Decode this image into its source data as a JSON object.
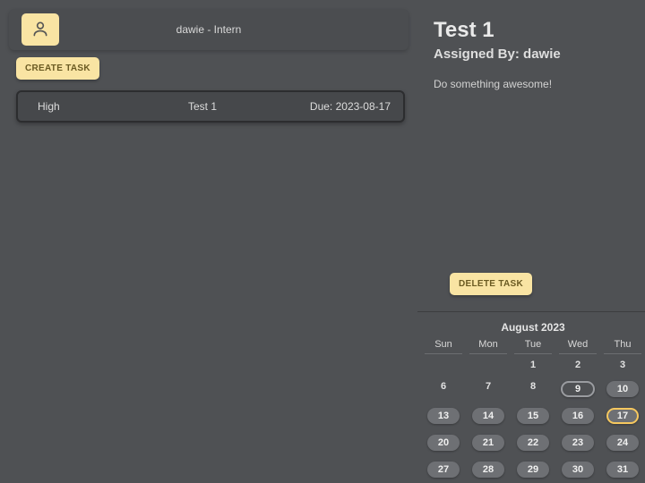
{
  "header": {
    "user_role": "dawie - Intern"
  },
  "actions": {
    "create_task": "CREATE TASK",
    "delete_task": "DELETE TASK"
  },
  "tasks": [
    {
      "priority": "High",
      "title": "Test 1",
      "due_prefix": "Due: ",
      "due": "2023-08-17"
    }
  ],
  "detail": {
    "title": "Test 1",
    "assigned_prefix": "Assigned By: ",
    "assigned_by": "dawie",
    "description": "Do something awesome!"
  },
  "calendar": {
    "title": "August 2023",
    "weekdays": [
      "Sun",
      "Mon",
      "Tue",
      "Wed",
      "Thu"
    ],
    "rows": [
      [
        {
          "n": "",
          "pill": false
        },
        {
          "n": "",
          "pill": false
        },
        {
          "n": "1",
          "pill": false
        },
        {
          "n": "2",
          "pill": false
        },
        {
          "n": "3",
          "pill": false
        }
      ],
      [
        {
          "n": "6",
          "pill": false
        },
        {
          "n": "7",
          "pill": false
        },
        {
          "n": "8",
          "pill": false
        },
        {
          "n": "9",
          "pill": true,
          "cls": "today"
        },
        {
          "n": "10",
          "pill": true
        }
      ],
      [
        {
          "n": "13",
          "pill": true
        },
        {
          "n": "14",
          "pill": true
        },
        {
          "n": "15",
          "pill": true
        },
        {
          "n": "16",
          "pill": true
        },
        {
          "n": "17",
          "pill": true,
          "cls": "selected"
        }
      ],
      [
        {
          "n": "20",
          "pill": true
        },
        {
          "n": "21",
          "pill": true
        },
        {
          "n": "22",
          "pill": true
        },
        {
          "n": "23",
          "pill": true
        },
        {
          "n": "24",
          "pill": true
        }
      ],
      [
        {
          "n": "27",
          "pill": true
        },
        {
          "n": "28",
          "pill": true
        },
        {
          "n": "29",
          "pill": true
        },
        {
          "n": "30",
          "pill": true
        },
        {
          "n": "31",
          "pill": true
        }
      ]
    ]
  }
}
